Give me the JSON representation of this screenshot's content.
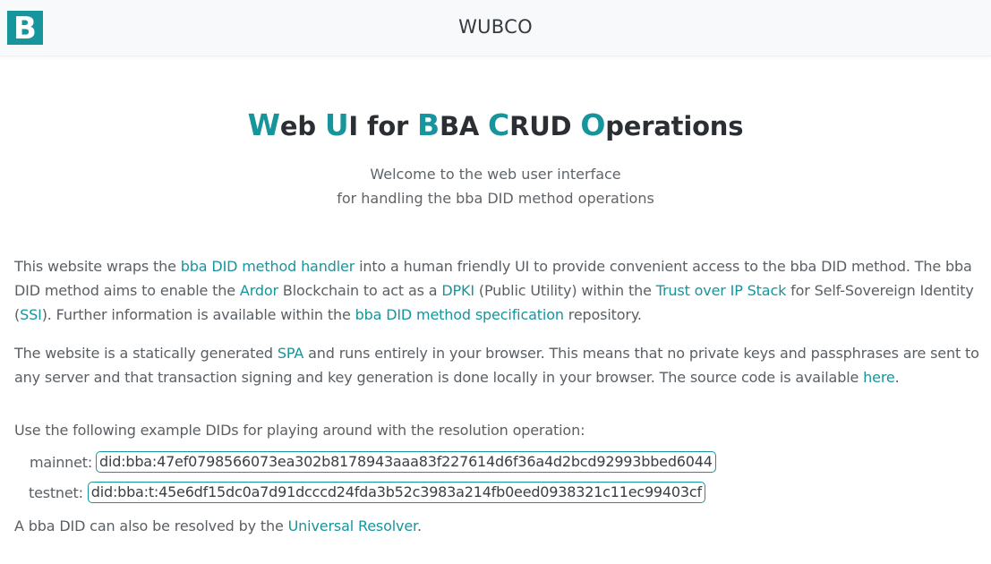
{
  "header": {
    "logo_letter": "B",
    "brand": "WUBCO"
  },
  "title": {
    "parts": [
      {
        "text": "W",
        "highlight": true
      },
      {
        "text": "eb ",
        "highlight": false
      },
      {
        "text": "U",
        "highlight": true
      },
      {
        "text": "I for ",
        "highlight": false
      },
      {
        "text": "B",
        "highlight": true
      },
      {
        "text": "BA ",
        "highlight": false
      },
      {
        "text": "C",
        "highlight": true
      },
      {
        "text": "RUD ",
        "highlight": false
      },
      {
        "text": "O",
        "highlight": true
      },
      {
        "text": "perations",
        "highlight": false
      }
    ]
  },
  "subtitle": {
    "line1": "Welcome to the web user interface",
    "line2": "for handling the bba DID method operations"
  },
  "intro": {
    "t1": "This website wraps the ",
    "link_handler": "bba DID method handler",
    "t2": " into a human friendly UI to provide convenient access to the bba DID method. The bba DID method aims to enable the ",
    "link_ardor": "Ardor",
    "t3": " Blockchain to act as a ",
    "link_dpki": "DPKI",
    "t4": " (Public Utility) within the ",
    "link_toip": "Trust over IP Stack",
    "t5": " for Self-Sovereign Identity (",
    "link_ssi": "SSI",
    "t6": "). Further information is available within the ",
    "link_spec": "bba DID method specification",
    "t7": " repository."
  },
  "spa": {
    "t1": "The website is a statically generated ",
    "link_spa": "SPA",
    "t2": " and runs entirely in your browser. This means that no private keys and passphrases are sent to any server and that transaction signing and key generation is done locally in your browser. The source code is available ",
    "link_here": "here",
    "t3": "."
  },
  "examples": {
    "intro": "Use the following example DIDs for playing around with the resolution operation:",
    "mainnet_label": "mainnet:",
    "mainnet_did": "did:bba:47ef0798566073ea302b8178943aaa83f227614d6f36a4d2bcd92993bbed6044",
    "testnet_label": "testnet:",
    "testnet_did": "did:bba:t:45e6df15dc0a7d91dcccd24fda3b52c3983a214fb0eed0938321c11ec99403cf"
  },
  "resolver": {
    "t1": "A bba DID can also be resolved by the ",
    "link_resolver": "Universal Resolver",
    "t2": "."
  }
}
